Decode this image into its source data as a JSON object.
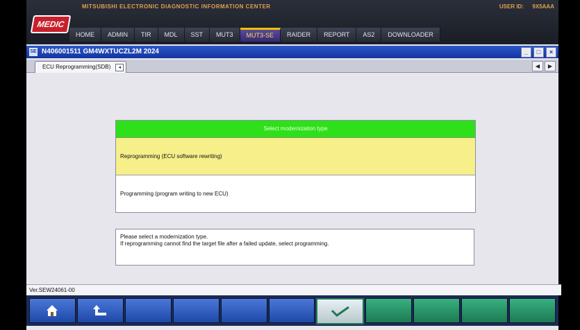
{
  "header": {
    "center_title": "MITSUBISHI ELECTRONIC DIAGNOSTIC INFORMATION CENTER",
    "logo_text": "MEDIC",
    "user_label": "USER ID:",
    "user_value": "9X5AAA",
    "nav": [
      "HOME",
      "ADMIN",
      "TIR",
      "MDL",
      "SST",
      "MUT3",
      "MUT3-SE",
      "RAIDER",
      "REPORT",
      "AS2",
      "DOWNLOADER"
    ],
    "active_nav": "MUT3-SE"
  },
  "window": {
    "icon_text": "SE",
    "title": "N406001511   GM4WXTUCZL2M 2024",
    "buttons": [
      "_",
      "□",
      "×"
    ]
  },
  "tabs": {
    "active_label": "ECU Reprogramming(SDB)",
    "close_glyph": "◂",
    "arrows": [
      "◀",
      "▶"
    ]
  },
  "selector": {
    "header": "Select modernization type",
    "options": [
      "Reprogramming (ECU software rewriting)",
      "Programming (program writing to new ECU)"
    ],
    "highlight_index": 0
  },
  "message": {
    "line1": "Please select a modernization type.",
    "line2": "If reprogramming cannot find the target file after a failed update, select programming."
  },
  "status": {
    "version": "Ver.SEW24061-00"
  },
  "toolbar": {
    "buttons": [
      "home-icon",
      "back-icon",
      "",
      "",
      "",
      "",
      "confirm-check-icon",
      "",
      "",
      "",
      ""
    ],
    "colors": {
      "blue": "#2e5cc0",
      "green": "#2a9466"
    }
  }
}
